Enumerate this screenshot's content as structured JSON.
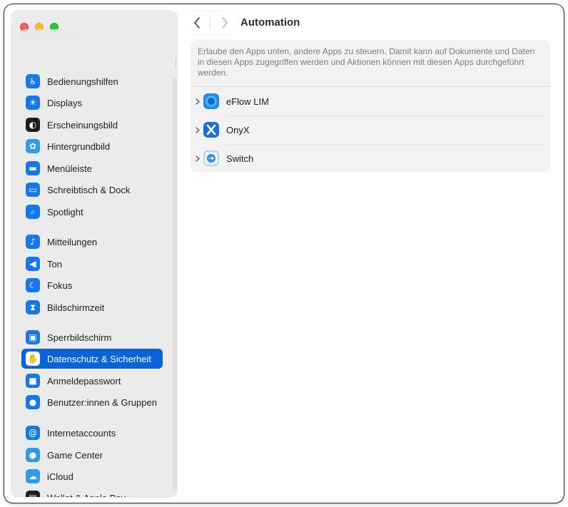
{
  "window": {
    "title": "Automation"
  },
  "sidebar": {
    "items": [
      {
        "label": "Bedienungshilfen",
        "icon": "accessibility-icon",
        "glyph": "♿",
        "color": "#1577ec",
        "selected": false
      },
      {
        "label": "Displays",
        "icon": "display-brightness-icon",
        "glyph": "☀",
        "color": "#1577ec",
        "selected": false
      },
      {
        "label": "Erscheinungsbild",
        "icon": "appearance-icon",
        "glyph": "◐",
        "color": "#1d1d1f",
        "selected": false
      },
      {
        "label": "Hintergrundbild",
        "icon": "wallpaper-icon",
        "glyph": "✿",
        "color": "#2b9bf4",
        "selected": false
      },
      {
        "label": "Menüleiste",
        "icon": "menubar-icon",
        "glyph": "▬",
        "color": "#1577ec",
        "selected": false
      },
      {
        "label": "Schreibtisch & Dock",
        "icon": "dock-icon",
        "glyph": "▭",
        "color": "#1577ec",
        "selected": false
      },
      {
        "label": "Spotlight",
        "icon": "spotlight-search-icon",
        "glyph": "⌕",
        "color": "#1577ec",
        "selected": false
      },
      {
        "label": "Mitteilungen",
        "icon": "notifications-bell-icon",
        "glyph": "♪",
        "color": "#1577ec",
        "selected": false
      },
      {
        "label": "Ton",
        "icon": "sound-speaker-icon",
        "glyph": "◀",
        "color": "#1577ec",
        "selected": false
      },
      {
        "label": "Fokus",
        "icon": "focus-moon-icon",
        "glyph": "☾",
        "color": "#1577ec",
        "selected": false
      },
      {
        "label": "Bildschirmzeit",
        "icon": "screentime-hourglass-icon",
        "glyph": "⧗",
        "color": "#1577ec",
        "selected": false
      },
      {
        "label": "Sperrbildschirm",
        "icon": "lockscreen-icon",
        "glyph": "▣",
        "color": "#1577ec",
        "selected": false
      },
      {
        "label": "Datenschutz & Sicherheit",
        "icon": "privacy-hand-icon",
        "glyph": "✋",
        "color": "#1577ec",
        "selected": true
      },
      {
        "label": "Anmeldepasswort",
        "icon": "password-lock-icon",
        "glyph": "■",
        "color": "#1577ec",
        "selected": false
      },
      {
        "label": "Benutzer:innen & Gruppen",
        "icon": "users-groups-icon",
        "glyph": "●",
        "color": "#1577ec",
        "selected": false
      },
      {
        "label": "Internetaccounts",
        "icon": "internet-accounts-at-icon",
        "glyph": "@",
        "color": "#1577ec",
        "selected": false
      },
      {
        "label": "Game Center",
        "icon": "game-center-icon",
        "glyph": "●",
        "color": "#2b9bf4",
        "selected": false
      },
      {
        "label": "iCloud",
        "icon": "icloud-icon",
        "glyph": "☁",
        "color": "#2b9bf4",
        "selected": false
      },
      {
        "label": "Wallet & Apple Pay",
        "icon": "wallet-icon",
        "glyph": "▤",
        "color": "#1d1d1f",
        "selected": false
      }
    ]
  },
  "main": {
    "description": "Erlaube den Apps unten, andere Apps zu steuern. Damit kann auf Dokumente und Daten in diesen Apps zugegriffen werden und Aktionen können mit diesen Apps durchgeführt werden.",
    "apps": [
      {
        "name": "eFlow LIM",
        "icon": "eflow-app-icon"
      },
      {
        "name": "OnyX",
        "icon": "onyx-app-icon"
      },
      {
        "name": "Switch",
        "icon": "switch-app-icon"
      }
    ]
  }
}
